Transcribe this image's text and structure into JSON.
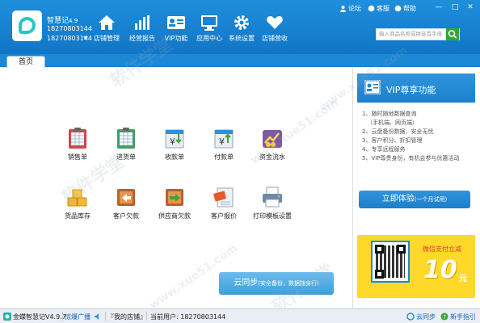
{
  "header": {
    "app_name": "智慧记",
    "app_version": "4.9",
    "user_phone_line1": "18270803144",
    "user_phone_line2": "18270803144",
    "nav": [
      {
        "label": "店铺管理",
        "icon": "home-icon"
      },
      {
        "label": "经营报告",
        "icon": "bar-chart-icon"
      },
      {
        "label": "VIP功能",
        "icon": "vip-card-icon"
      },
      {
        "label": "应用中心",
        "icon": "monitor-icon"
      },
      {
        "label": "系统设置",
        "icon": "gear-icon"
      },
      {
        "label": "店铺营收",
        "icon": "heart-icon"
      }
    ],
    "top_links": {
      "forum": "论坛",
      "service": "客服",
      "help": "帮助"
    },
    "search_placeholder": "输入商品名称或拼音首字母"
  },
  "tabs": {
    "home": "首页"
  },
  "main": {
    "items": [
      {
        "label": "销售单",
        "icon": "sales-order-icon"
      },
      {
        "label": "进货单",
        "icon": "purchase-order-icon"
      },
      {
        "label": "收款单",
        "icon": "receipt-icon"
      },
      {
        "label": "付款单",
        "icon": "payment-icon"
      },
      {
        "label": "资金流水",
        "icon": "cash-flow-icon"
      },
      {
        "label": "货品库存",
        "icon": "inventory-icon"
      },
      {
        "label": "客户欠款",
        "icon": "customer-debt-icon"
      },
      {
        "label": "供应商欠款",
        "icon": "supplier-debt-icon"
      },
      {
        "label": "客户报价",
        "icon": "customer-quote-icon"
      },
      {
        "label": "打印模板设置",
        "icon": "printer-icon"
      }
    ],
    "sync": {
      "title": "云同步",
      "subtitle": "(安全备份，数据随身行)"
    }
  },
  "vip": {
    "title": "VIP尊享功能",
    "features": [
      "1、随时随地数据查询",
      "（手机端、网页端）",
      "2、云盘备份数据、安全无忧",
      "3、客户积分、折扣管理",
      "4、专享远程服务",
      "5、VIP尊贵身份，有机会参与优惠活动"
    ],
    "trial_label": "立即体验",
    "trial_sub": "(一个月试用)",
    "promo_pay": "微信支付立减",
    "promo_amount": "10",
    "promo_unit": "元"
  },
  "status_bar": {
    "app": "金蝶智慧记V4.9.7",
    "broadcast": "惊爆广播",
    "shop": "『我的店铺』",
    "current_user": "当前用户: 18270803144",
    "cloud_sync": "云同步",
    "guide": "新手指引"
  },
  "watermark": [
    "软件学堂",
    "www.xue51.com"
  ],
  "colors": {
    "header": "#1a84d2",
    "sync_button": "#4aa6df",
    "promo": "#ffd92a"
  }
}
